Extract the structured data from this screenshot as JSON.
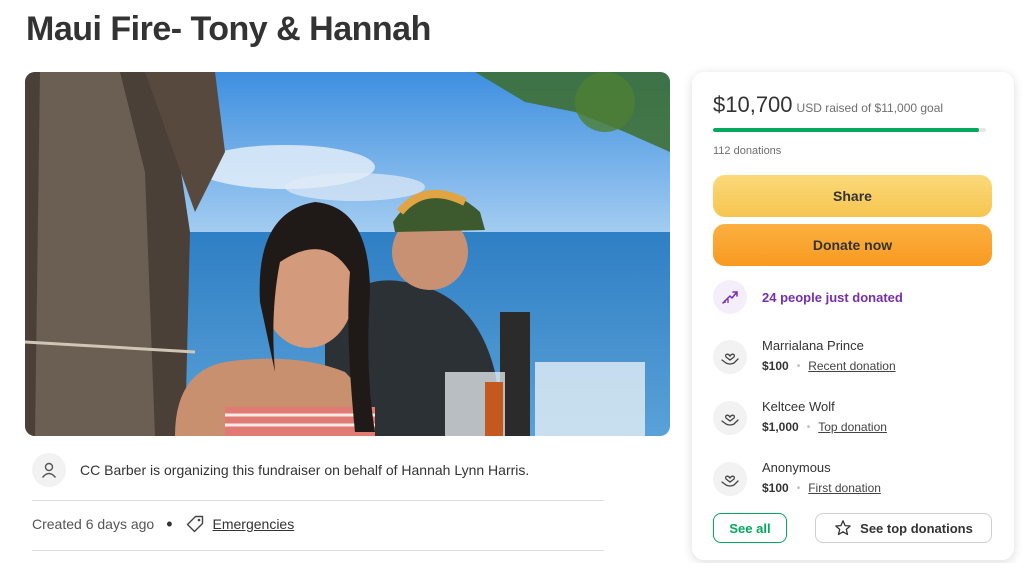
{
  "page": {
    "title": "Maui Fire- Tony & Hannah"
  },
  "organizer": {
    "text": "CC Barber is organizing this fundraiser on behalf of Hannah Lynn Harris."
  },
  "meta": {
    "created": "Created 6 days ago",
    "separator": "•",
    "category": "Emergencies"
  },
  "card": {
    "raised_amount": "$10,700",
    "raised_rest": "USD raised of $11,000 goal",
    "progress_fraction": 0.973,
    "donations_count": "112 donations",
    "share_label": "Share",
    "donate_label": "Donate now",
    "recent_notice": "24 people just donated",
    "donors": [
      {
        "name": "Marrialana Prince",
        "amount": "$100",
        "type": "Recent donation"
      },
      {
        "name": "Keltcee Wolf",
        "amount": "$1,000",
        "type": "Top donation"
      },
      {
        "name": "Anonymous",
        "amount": "$100",
        "type": "First donation"
      }
    ],
    "see_all_label": "See all",
    "see_top_label": "See top donations"
  },
  "colors": {
    "accent_green": "#02a95c",
    "share_yellow": "#f6c550",
    "donate_orange": "#f89a21",
    "purple": "#752eb0"
  },
  "icons": {
    "organizer": "person-icon",
    "category": "tag-icon",
    "recent": "trending-up-icon",
    "donor": "heart-hand-icon",
    "top": "star-icon"
  }
}
